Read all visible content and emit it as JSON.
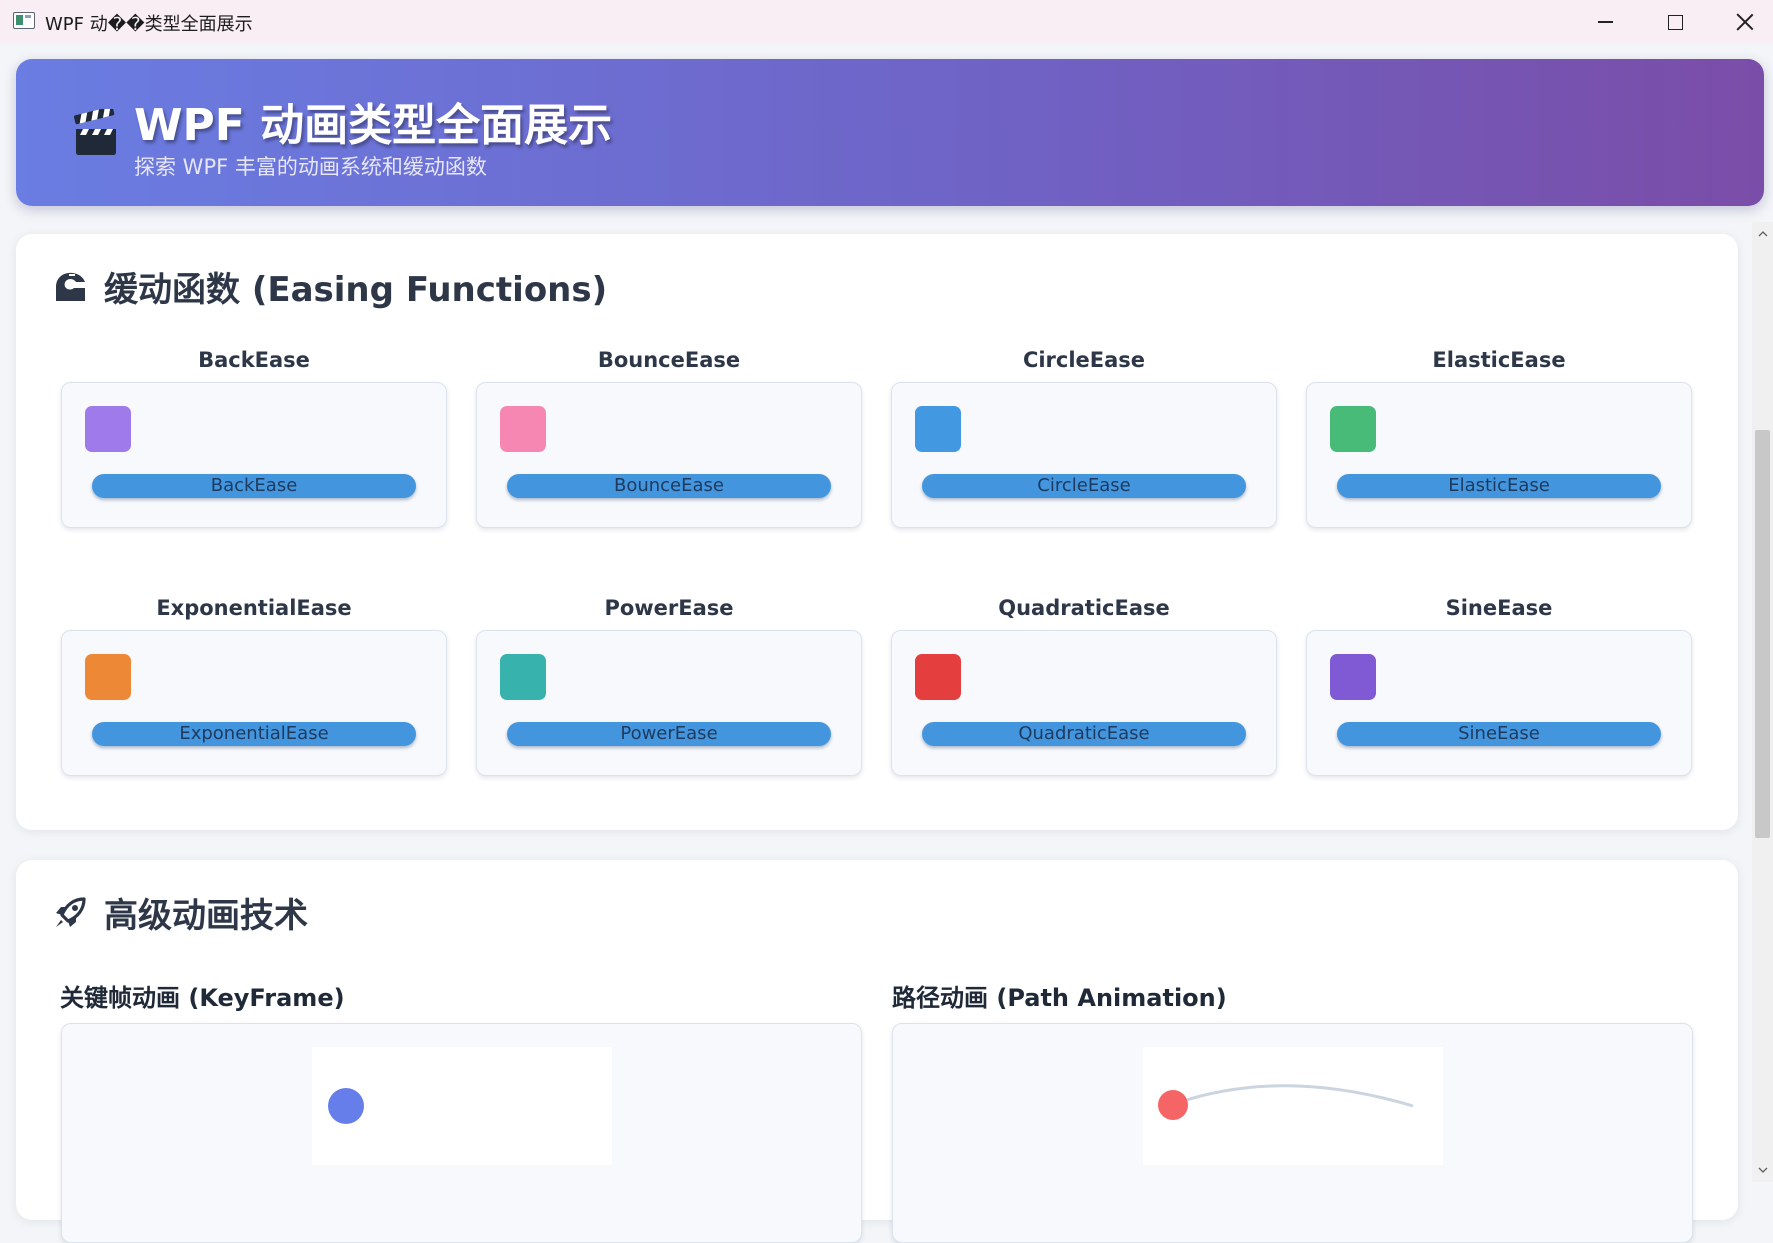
{
  "window": {
    "title": "WPF 动��类型全面展示",
    "minimize_icon": "minimize-icon",
    "maximize_icon": "maximize-icon",
    "close_icon": "close-icon"
  },
  "header": {
    "icon": "clapperboard-icon",
    "title": "WPF 动画类型全面展示",
    "subtitle": "探索 WPF 丰富的动画系统和缓动函数",
    "gradient_start": "#6a7de2",
    "gradient_end": "#7a4da8"
  },
  "easing_section": {
    "icon": "easing-curve-icon",
    "title": "缓动函数 (Easing Functions)",
    "items": [
      {
        "title": "BackEase",
        "button_label": "BackEase",
        "color": "#9f7aea"
      },
      {
        "title": "BounceEase",
        "button_label": "BounceEase",
        "color": "#f687b3"
      },
      {
        "title": "CircleEase",
        "button_label": "CircleEase",
        "color": "#4299e1"
      },
      {
        "title": "ElasticEase",
        "button_label": "ElasticEase",
        "color": "#48bb78"
      },
      {
        "title": "ExponentialEase",
        "button_label": "ExponentialEase",
        "color": "#ed8936"
      },
      {
        "title": "PowerEase",
        "button_label": "PowerEase",
        "color": "#38b2ac"
      },
      {
        "title": "QuadraticEase",
        "button_label": "QuadraticEase",
        "color": "#e53e3e"
      },
      {
        "title": "SineEase",
        "button_label": "SineEase",
        "color": "#805ad5"
      }
    ],
    "button_color": "#4396de"
  },
  "advanced_section": {
    "icon": "rocket-icon",
    "title": "高级动画技术",
    "keyframe": {
      "title": "关键帧动画 (KeyFrame)",
      "ball_color": "#667eea"
    },
    "path": {
      "title": "路径动画 (Path Animation)",
      "ball_color": "#f56565",
      "path_color": "#cbd5e0"
    }
  }
}
